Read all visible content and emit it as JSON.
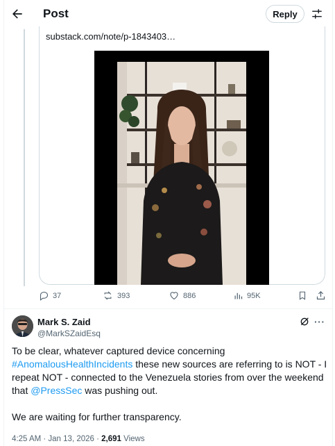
{
  "header": {
    "title": "Post",
    "reply_label": "Reply"
  },
  "quoted": {
    "link_text": "substack.com/note/p-1843403…",
    "stats": {
      "replies": "37",
      "reposts": "393",
      "likes": "886",
      "views": "95K"
    }
  },
  "post": {
    "author_name": "Mark S. Zaid",
    "author_handle": "@MarkSZaidEsq",
    "paragraph1": {
      "part1": "To be clear, whatever captured device concerning ",
      "hashtag": "#AnomalousHealthIncidents",
      "part2": " these new sources are referring to is NOT - I repeat NOT - connected to the Venezuela stories from over the weekend that ",
      "mention": "@PressSec",
      "part3": " was pushing out."
    },
    "paragraph2": "We are waiting for further transparency.",
    "timestamp": "4:25 AM · Jan 13, 2026 · ",
    "view_count": "2,691",
    "views_label": " Views"
  },
  "colors": {
    "accent": "#1d9bf0",
    "text": "#0f1419",
    "muted": "#536471",
    "border": "#cfd9de"
  },
  "icons": [
    "back-arrow-icon",
    "tune-icon",
    "reply-icon",
    "repost-icon",
    "like-icon",
    "views-icon",
    "bookmark-icon",
    "share-icon",
    "grok-icon",
    "more-icon"
  ]
}
